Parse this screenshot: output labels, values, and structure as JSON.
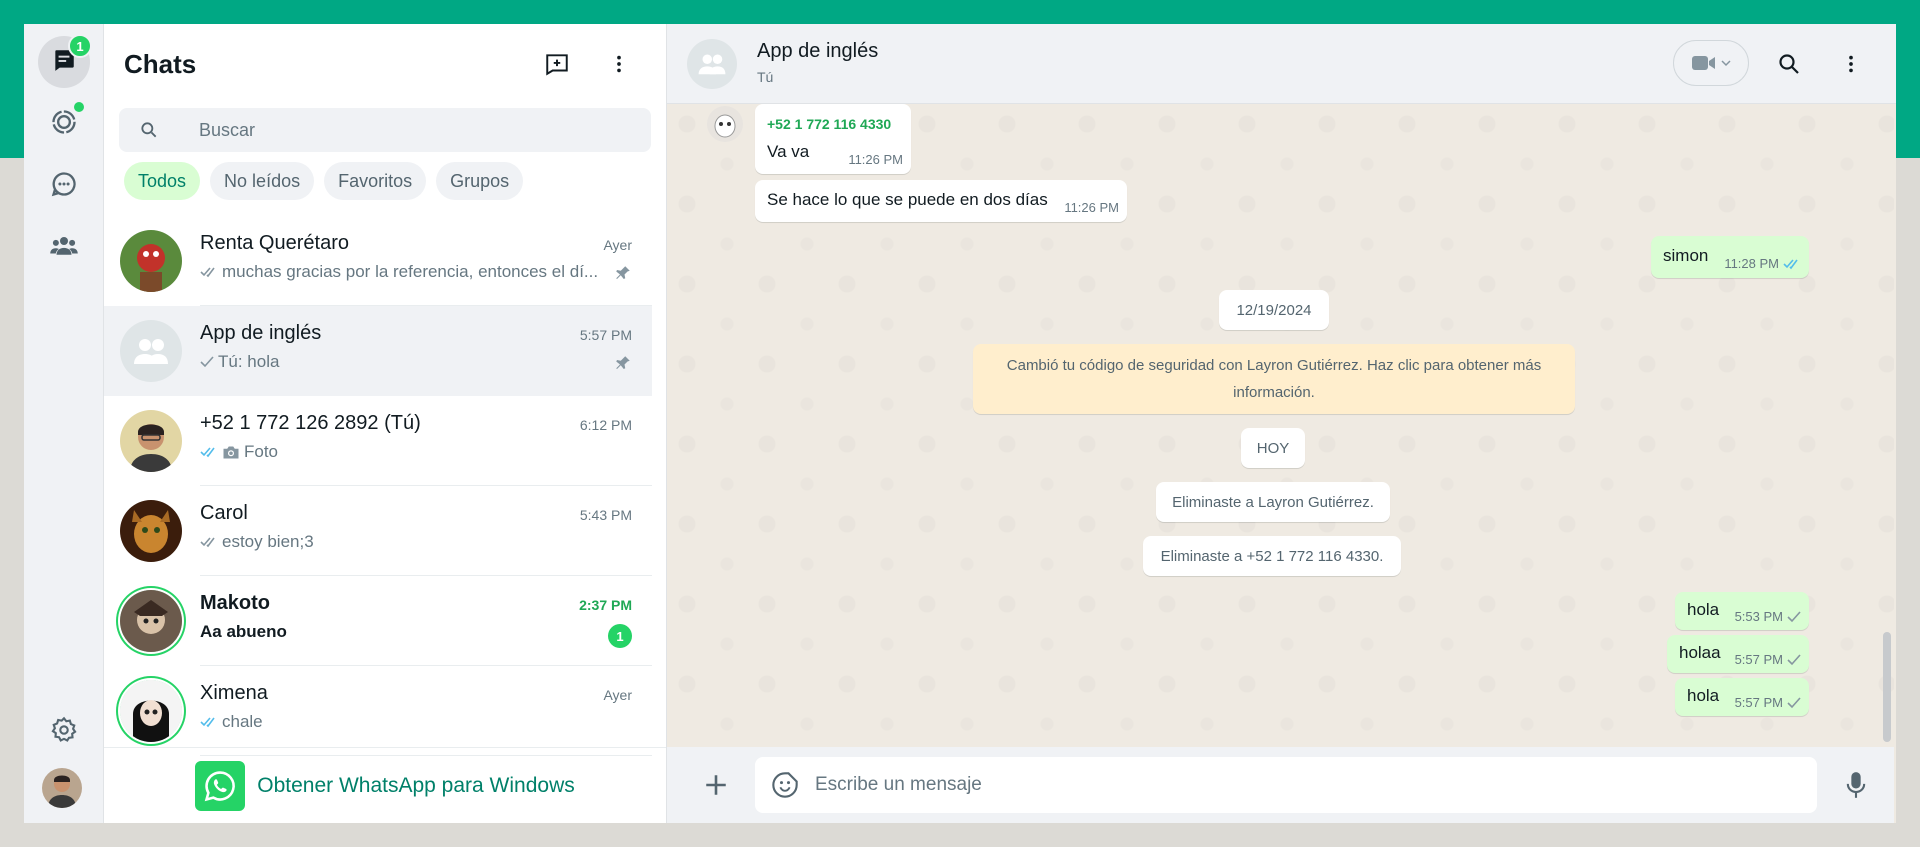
{
  "rail": {
    "chats_badge": "1",
    "icons": [
      "chats-icon",
      "status-icon",
      "channels-icon",
      "communities-icon",
      "settings-icon"
    ]
  },
  "list": {
    "title": "Chats",
    "search_placeholder": "Buscar",
    "filters": [
      "Todos",
      "No leídos",
      "Favoritos",
      "Grupos"
    ],
    "chats": [
      {
        "name": "Renta Querétaro",
        "time": "Ayer",
        "preview": "muchas gracias por la referencia, entonces el dí...",
        "ticks": "double-gray",
        "pinned": true
      },
      {
        "name": "App de inglés",
        "time": "5:57 PM",
        "preview": "Tú: hola",
        "ticks": "single",
        "pinned": true
      },
      {
        "name": "+52 1 772 126 2892 (Tú)",
        "time": "6:12 PM",
        "preview": "Foto",
        "ticks": "double-blue",
        "camera": true
      },
      {
        "name": "Carol",
        "time": "5:43 PM",
        "preview": "estoy bien;3",
        "ticks": "double-gray"
      },
      {
        "name": "Makoto",
        "time": "2:37 PM",
        "preview": "Aa abueno",
        "unread": "1"
      },
      {
        "name": "Ximena",
        "time": "Ayer",
        "preview": "chale",
        "ticks": "double-blue"
      }
    ],
    "get_app": "Obtener WhatsApp para Windows"
  },
  "conversation": {
    "title": "App de inglés",
    "subtitle": "Tú",
    "messages": {
      "m1_sender": "+52 1 772 116 4330",
      "m1_text": "Va va",
      "m1_time": "11:26 PM",
      "m2_text": "Se hace lo que se puede en dos días",
      "m2_time": "11:26 PM",
      "m3_text": "simon",
      "m3_time": "11:28 PM",
      "date1": "12/19/2024",
      "security": "Cambió tu código de seguridad con Layron Gutiérrez. Haz clic para obtener más información.",
      "date2": "HOY",
      "sys1": "Eliminaste a Layron Gutiérrez.",
      "sys2": "Eliminaste a +52 1 772 116 4330.",
      "m4_text": "hola",
      "m4_time": "5:53 PM",
      "m5_text": "holaa",
      "m5_time": "5:57 PM",
      "m6_text": "hola",
      "m6_time": "5:57 PM"
    },
    "composer_placeholder": "Escribe un mensaje"
  },
  "colors": {
    "brand": "#00a884",
    "accent": "#25d366",
    "outgoing": "#d9fdd3",
    "read_tick": "#53bdeb"
  }
}
